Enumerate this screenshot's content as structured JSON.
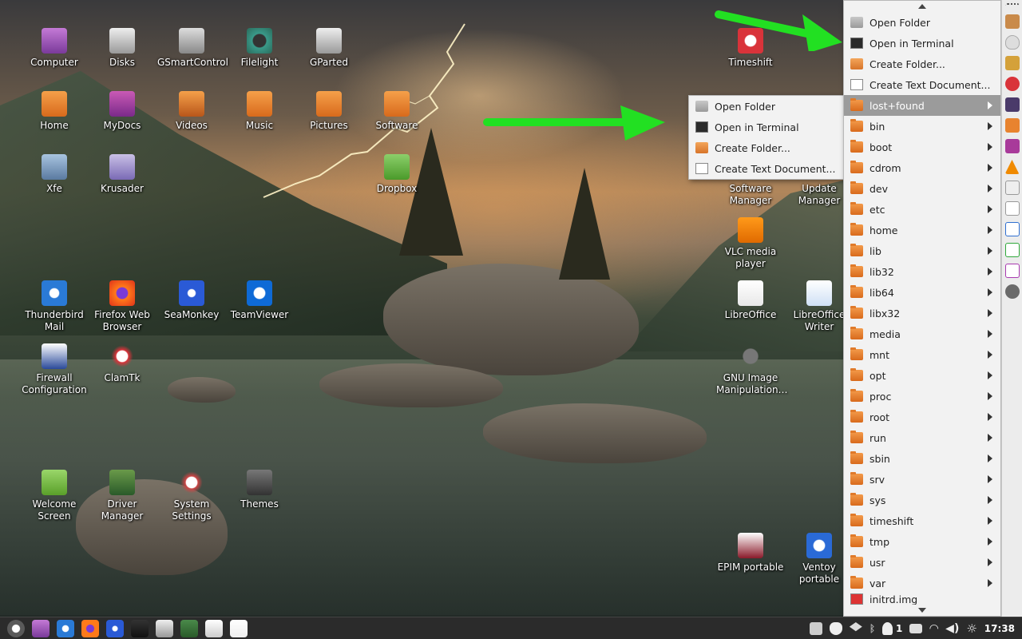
{
  "desktop_icons": [
    {
      "label": "Computer",
      "icon": "computer-icon"
    },
    {
      "label": "Disks",
      "icon": "disks-icon"
    },
    {
      "label": "GSmartControl",
      "icon": "gsmartcontrol-icon"
    },
    {
      "label": "Filelight",
      "icon": "filelight-icon"
    },
    {
      "label": "GParted",
      "icon": "gparted-icon"
    },
    {
      "label": "Timeshift",
      "icon": "timeshift-icon"
    },
    {
      "label": "Home",
      "icon": "home-folder-icon"
    },
    {
      "label": "MyDocs",
      "icon": "mydocs-icon"
    },
    {
      "label": "Videos",
      "icon": "videos-folder-icon"
    },
    {
      "label": "Music",
      "icon": "music-folder-icon"
    },
    {
      "label": "Pictures",
      "icon": "pictures-folder-icon"
    },
    {
      "label": "Software",
      "icon": "software-folder-icon"
    },
    {
      "label": "Xfe",
      "icon": "xfe-icon"
    },
    {
      "label": "Krusader",
      "icon": "krusader-icon"
    },
    {
      "label": "Dropbox",
      "icon": "dropbox-folder-icon"
    },
    {
      "label": "Software\nManager",
      "icon": "software-manager-icon"
    },
    {
      "label": "Update\nManager",
      "icon": "update-manager-icon"
    },
    {
      "label": "VLC media\nplayer",
      "icon": "vlc-icon"
    },
    {
      "label": "Thunderbird\nMail",
      "icon": "thunderbird-icon"
    },
    {
      "label": "Firefox Web\nBrowser",
      "icon": "firefox-icon"
    },
    {
      "label": "SeaMonkey",
      "icon": "seamonkey-icon"
    },
    {
      "label": "TeamViewer",
      "icon": "teamviewer-icon"
    },
    {
      "label": "LibreOffice",
      "icon": "libreoffice-icon"
    },
    {
      "label": "LibreOffice\nWriter",
      "icon": "libreoffice-writer-icon"
    },
    {
      "label": "Firewall\nConfiguration",
      "icon": "firewall-icon"
    },
    {
      "label": "ClamTk",
      "icon": "clamtk-icon"
    },
    {
      "label": "GNU Image\nManipulation…",
      "icon": "gimp-icon"
    },
    {
      "label": "Welcome\nScreen",
      "icon": "welcome-screen-icon"
    },
    {
      "label": "Driver\nManager",
      "icon": "driver-manager-icon"
    },
    {
      "label": "System\nSettings",
      "icon": "system-settings-icon"
    },
    {
      "label": "Themes",
      "icon": "themes-icon"
    },
    {
      "label": "EPIM portable",
      "icon": "epim-icon"
    },
    {
      "label": "Ventoy\nportable",
      "icon": "ventoy-icon"
    }
  ],
  "submenu": {
    "items": [
      "Open Folder",
      "Open in Terminal",
      "Create Folder...",
      "Create Text Document..."
    ]
  },
  "main_menu": {
    "actions": [
      "Open Folder",
      "Open in Terminal",
      "Create Folder...",
      "Create Text Document..."
    ],
    "folders": [
      "lost+found",
      "bin",
      "boot",
      "cdrom",
      "dev",
      "etc",
      "home",
      "lib",
      "lib32",
      "lib64",
      "libx32",
      "media",
      "mnt",
      "opt",
      "proc",
      "root",
      "run",
      "sbin",
      "srv",
      "sys",
      "timeshift",
      "tmp",
      "usr",
      "var"
    ],
    "partial_item": "initrd.img",
    "selected": "lost+found"
  },
  "taskbar": {
    "clock": "17:38",
    "notification_count": "1",
    "launchers": [
      "mint-menu-icon",
      "file-manager-icon",
      "thunderbird-icon",
      "firefox-icon",
      "seamonkey-icon",
      "terminal-icon",
      "calendar-icon",
      "calculator-icon",
      "text-editor-icon",
      "document-icon"
    ]
  },
  "colors": {
    "menu_bg": "#f2f2f2",
    "menu_selected": "#9b9b9b",
    "folder_orange": "#e8832f",
    "arrow_green": "#22e022",
    "taskbar_bg": "#2b2b2b"
  }
}
